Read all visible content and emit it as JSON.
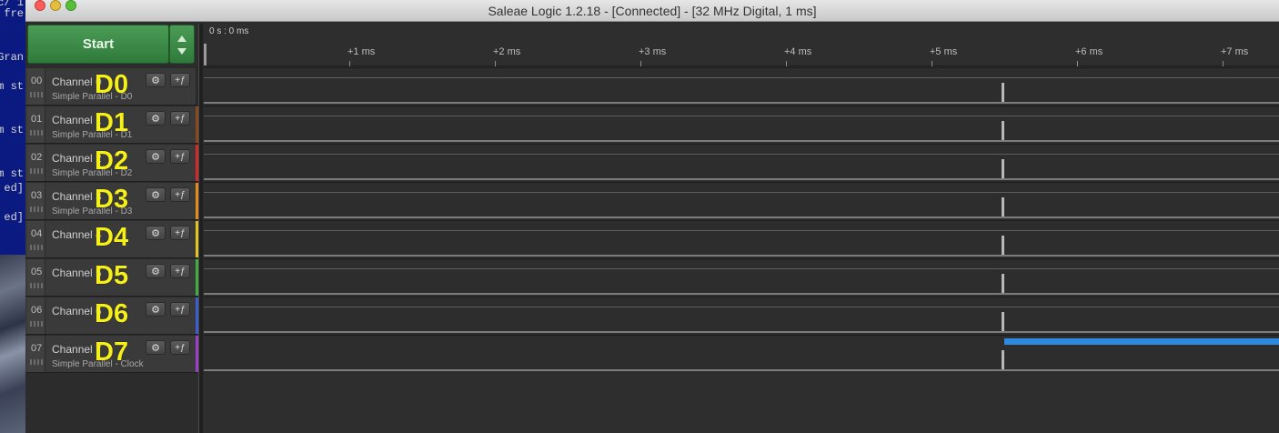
{
  "window": {
    "title": "Saleae Logic 1.2.18 - [Connected] - [32 MHz Digital, 1 ms]",
    "traffic_colors": {
      "close": "#fc5b57",
      "minimize": "#e5bf3c",
      "zoom": "#57c038"
    }
  },
  "background_terminal": {
    "lines": [
      "c/ 1",
      "fre",
      "Gran",
      "m st",
      "m st",
      "m st",
      "ed]",
      "ed]"
    ]
  },
  "controls": {
    "start_label": "Start",
    "start_color": "#3a8a46"
  },
  "timeline": {
    "origin": "0 s : 0 ms",
    "ticks": [
      "+1 ms",
      "+2 ms",
      "+3 ms",
      "+4 ms",
      "+5 ms",
      "+6 ms",
      "+7 ms"
    ]
  },
  "channels": [
    {
      "num": "00",
      "name": "Channel 0",
      "sub": "Simple Parallel - D0",
      "overlay": "D0",
      "color": "#2a2a2a"
    },
    {
      "num": "01",
      "name": "Channel 1",
      "sub": "Simple Parallel - D1",
      "overlay": "D1",
      "color": "#8b4a1e"
    },
    {
      "num": "02",
      "name": "Channel 2",
      "sub": "Simple Parallel - D2",
      "overlay": "D2",
      "color": "#d42a2a"
    },
    {
      "num": "03",
      "name": "Channel 3",
      "sub": "Simple Parallel - D3",
      "overlay": "D3",
      "color": "#e58b1a"
    },
    {
      "num": "04",
      "name": "Channel 4",
      "sub": "",
      "overlay": "D4",
      "color": "#e2c51c"
    },
    {
      "num": "05",
      "name": "Channel 5",
      "sub": "",
      "overlay": "D5",
      "color": "#3fae3f"
    },
    {
      "num": "06",
      "name": "Channel 6",
      "sub": "",
      "overlay": "D6",
      "color": "#3a5fd0"
    },
    {
      "num": "07",
      "name": "Channel 7",
      "sub": "Simple Parallel - Clock",
      "overlay": "D7",
      "color": "#9a3fc8"
    }
  ],
  "clock_bar_color": "#2d8ae0"
}
